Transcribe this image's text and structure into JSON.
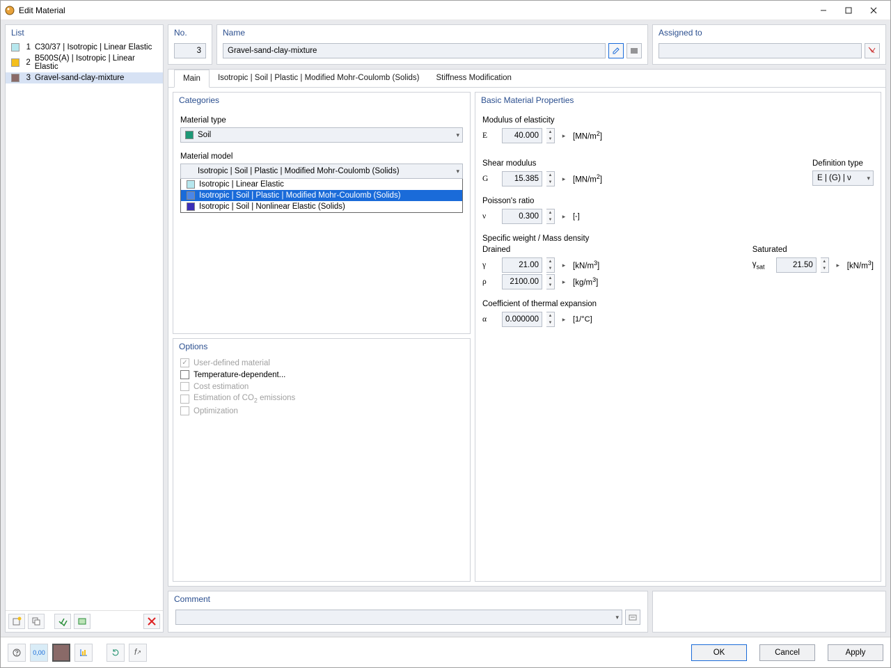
{
  "window": {
    "title": "Edit Material"
  },
  "left": {
    "section": "List",
    "items": [
      {
        "num": "1",
        "color": "#b6e7ee",
        "label": "C30/37 | Isotropic | Linear Elastic"
      },
      {
        "num": "2",
        "color": "#f4bf1d",
        "label": "B500S(A) | Isotropic | Linear Elastic"
      },
      {
        "num": "3",
        "color": "#8a6a68",
        "label": "Gravel-sand-clay-mixture"
      }
    ]
  },
  "header": {
    "no_label": "No.",
    "no_value": "3",
    "name_label": "Name",
    "name_value": "Gravel-sand-clay-mixture",
    "assigned_label": "Assigned to",
    "assigned_value": ""
  },
  "tabs": {
    "t0": "Main",
    "t1": "Isotropic | Soil | Plastic | Modified Mohr-Coulomb (Solids)",
    "t2": "Stiffness Modification"
  },
  "categories": {
    "section": "Categories",
    "mat_type_label": "Material type",
    "mat_type_value": "Soil",
    "mat_type_color": "#1d9877",
    "mat_model_label": "Material model",
    "mat_model_value": "Isotropic | Soil | Plastic | Modified Mohr-Coulomb (Solids)",
    "dd0": {
      "color": "#b6e7ee",
      "label": "Isotropic | Linear Elastic"
    },
    "dd1": {
      "color": "#4a86e8",
      "label": "Isotropic | Soil | Plastic | Modified Mohr-Coulomb (Solids)"
    },
    "dd2": {
      "color": "#3b2fb8",
      "label": "Isotropic | Soil | Nonlinear Elastic (Solids)"
    }
  },
  "options": {
    "section": "Options",
    "o0": "User-defined material",
    "o1": "Temperature-dependent...",
    "o2": "Cost estimation",
    "o3_a": "Estimation of CO",
    "o3_b": " emissions",
    "o3_sub": "2",
    "o4": "Optimization"
  },
  "props": {
    "section": "Basic Material Properties",
    "mod_e_label": "Modulus of elasticity",
    "E_sym": "E",
    "E_val": "40.000",
    "E_unit_a": "[MN/m",
    "E_unit_sup": "2",
    "E_unit_b": "]",
    "shear_label": "Shear modulus",
    "G_sym": "G",
    "G_val": "15.385",
    "G_unit_a": "[MN/m",
    "G_unit_sup": "2",
    "G_unit_b": "]",
    "def_type_label": "Definition type",
    "def_type_value": "E | (G) | ν",
    "poisson_label": "Poisson's ratio",
    "nu_sym": "ν",
    "nu_val": "0.300",
    "nu_unit": "[-]",
    "specweight_label": "Specific weight / Mass density",
    "drained_label": "Drained",
    "saturated_label": "Saturated",
    "gamma_sym": "γ",
    "gamma_val": "21.00",
    "gamma_unit_a": "[kN/m",
    "gamma_unit_sup": "3",
    "gamma_unit_b": "]",
    "rho_sym": "ρ",
    "rho_val": "2100.00",
    "rho_unit_a": "[kg/m",
    "rho_unit_sup": "3",
    "rho_unit_b": "]",
    "gammasat_sym_a": "γ",
    "gammasat_sym_sub": "sat",
    "gammasat_val": "21.50",
    "gammasat_unit_a": "[kN/m",
    "gammasat_unit_sup": "3",
    "gammasat_unit_b": "]",
    "thermal_label": "Coefficient of thermal expansion",
    "alpha_sym": "α",
    "alpha_val": "0.000000",
    "alpha_unit": "[1/°C]"
  },
  "comment": {
    "section": "Comment",
    "value": ""
  },
  "footer": {
    "ok": "OK",
    "cancel": "Cancel",
    "apply": "Apply"
  }
}
